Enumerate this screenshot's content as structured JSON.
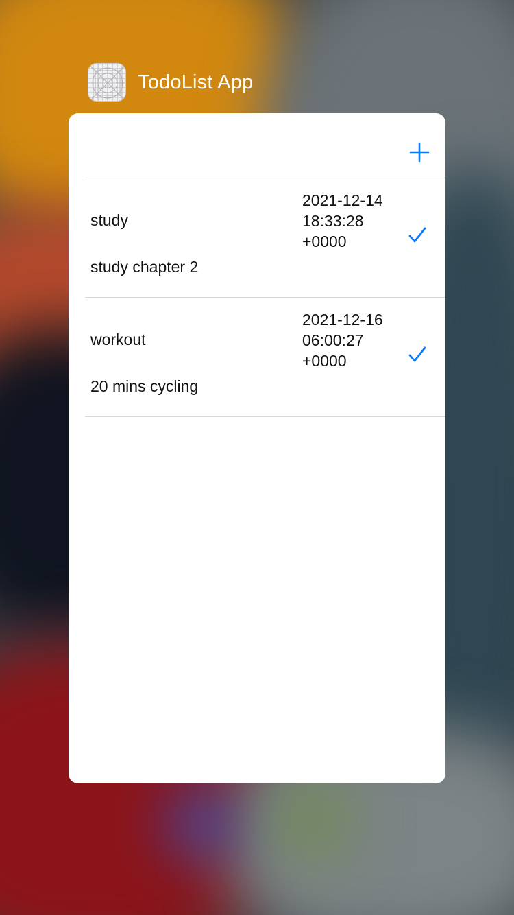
{
  "app": {
    "name": "TodoList App",
    "icon": "app-icon-placeholder"
  },
  "toolbar": {
    "add_icon": "plus-icon"
  },
  "todos": [
    {
      "title": "study",
      "description": "study chapter 2",
      "date": "2021-12-14 18:33:28 +0000",
      "done": true,
      "check_icon": "checkmark-icon"
    },
    {
      "title": "workout",
      "description": "20 mins cycling",
      "date": "2021-12-16 06:00:27 +0000",
      "done": true,
      "check_icon": "checkmark-icon"
    }
  ],
  "colors": {
    "accent": "#0a7aff",
    "card_background": "#ffffff",
    "separator": "#d8d8dc"
  }
}
